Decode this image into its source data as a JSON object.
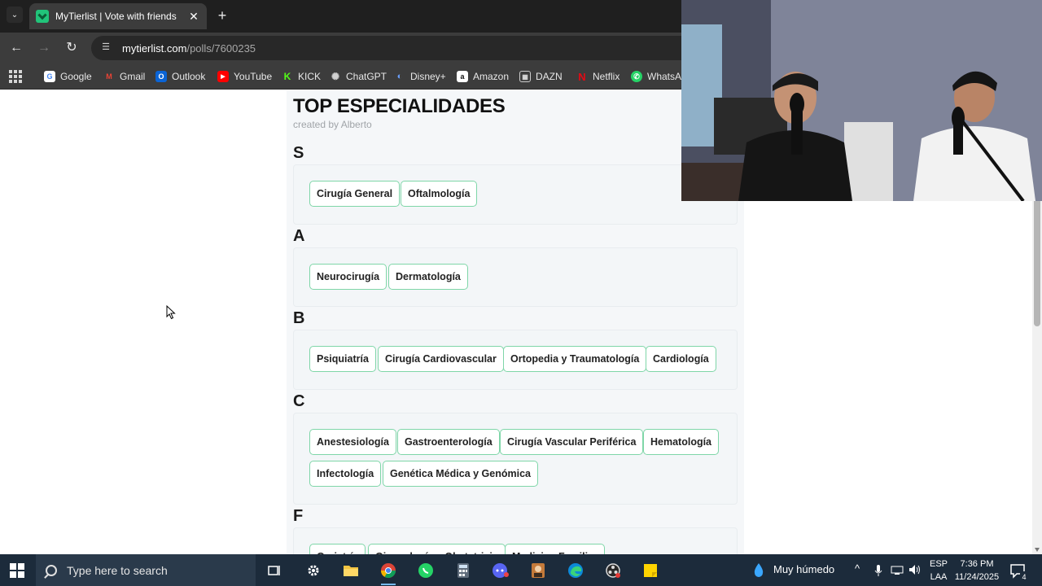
{
  "browser": {
    "tab_title": "MyTierlist | Vote with friends",
    "url_host": "mytierlist.com",
    "url_path": "/polls/7600235"
  },
  "bookmarks": [
    {
      "label": "Google",
      "color": "#4285f4",
      "glyph": "G"
    },
    {
      "label": "Gmail",
      "color": "#ea4335",
      "glyph": "M"
    },
    {
      "label": "Outlook",
      "color": "#0a64d6",
      "glyph": "O"
    },
    {
      "label": "YouTube",
      "color": "#ff0000",
      "glyph": "▶"
    },
    {
      "label": "KICK",
      "color": "#53fc18",
      "glyph": "K"
    },
    {
      "label": "ChatGPT",
      "color": "#555555",
      "glyph": "✺"
    },
    {
      "label": "Disney+",
      "color": "#1a3a8a",
      "glyph": "D"
    },
    {
      "label": "Amazon",
      "color": "#ffffff",
      "glyph": "a"
    },
    {
      "label": "DAZN",
      "color": "#222222",
      "glyph": "D"
    },
    {
      "label": "Netflix",
      "color": "#e50914",
      "glyph": "N"
    },
    {
      "label": "WhatsAp",
      "color": "#25d366",
      "glyph": "✆"
    }
  ],
  "page": {
    "title": "TOP ESPECIALIDADES",
    "creator": "created by Alberto"
  },
  "tiers": [
    {
      "label": "S",
      "items": [
        "Cirugía General",
        "Oftalmología"
      ]
    },
    {
      "label": "A",
      "items": [
        "Neurocirugía",
        "Dermatología"
      ]
    },
    {
      "label": "B",
      "items": [
        "Psiquiatría",
        "Cirugía Cardiovascular",
        "Ortopedia y Traumatología",
        "Cardiología"
      ]
    },
    {
      "label": "C",
      "items": [
        "Anestesiología",
        "Gastroenterología",
        "Cirugía Vascular Periférica",
        "Hematología",
        "Infectología",
        "Genética Médica y Genómica"
      ]
    },
    {
      "label": "F",
      "items": [
        "Geriatría",
        "Ginecología y Obstetricia",
        "Medicina Familiar"
      ]
    }
  ],
  "taskbar": {
    "search_placeholder": "Type here to search",
    "weather": "Muy húmedo",
    "lang_top": "ESP",
    "lang_bottom": "LAA",
    "time": "7:36 PM",
    "date": "11/24/2025",
    "notifications": "4"
  },
  "colors": {
    "chip_border": "#7fd6a8",
    "accent_green": "#21c47a"
  }
}
